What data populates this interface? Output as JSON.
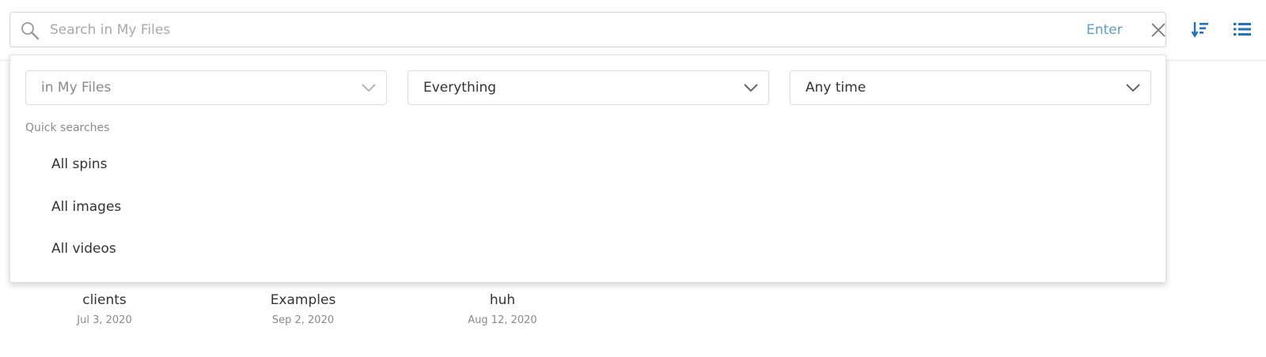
{
  "search": {
    "placeholder": "Search in My Files",
    "value": "",
    "enter_label": "Enter",
    "icons": {
      "search": "search-icon",
      "clear": "close-icon"
    }
  },
  "toolbar": {
    "icons": {
      "sort": "sort-descending-icon",
      "view": "list-view-icon"
    },
    "accent_color": "#1e73be"
  },
  "filters": {
    "scope": {
      "value": "in My Files",
      "disabled": true
    },
    "type": {
      "value": "Everything"
    },
    "time": {
      "value": "Any time"
    }
  },
  "quick_searches": {
    "title": "Quick searches",
    "items": [
      {
        "label": "All spins"
      },
      {
        "label": "All images"
      },
      {
        "label": "All videos"
      }
    ]
  },
  "files": [
    {
      "name": "clients",
      "date": "Jul 3, 2020"
    },
    {
      "name": "Examples",
      "date": "Sep 2, 2020"
    },
    {
      "name": "huh",
      "date": "Aug 12, 2020"
    }
  ]
}
